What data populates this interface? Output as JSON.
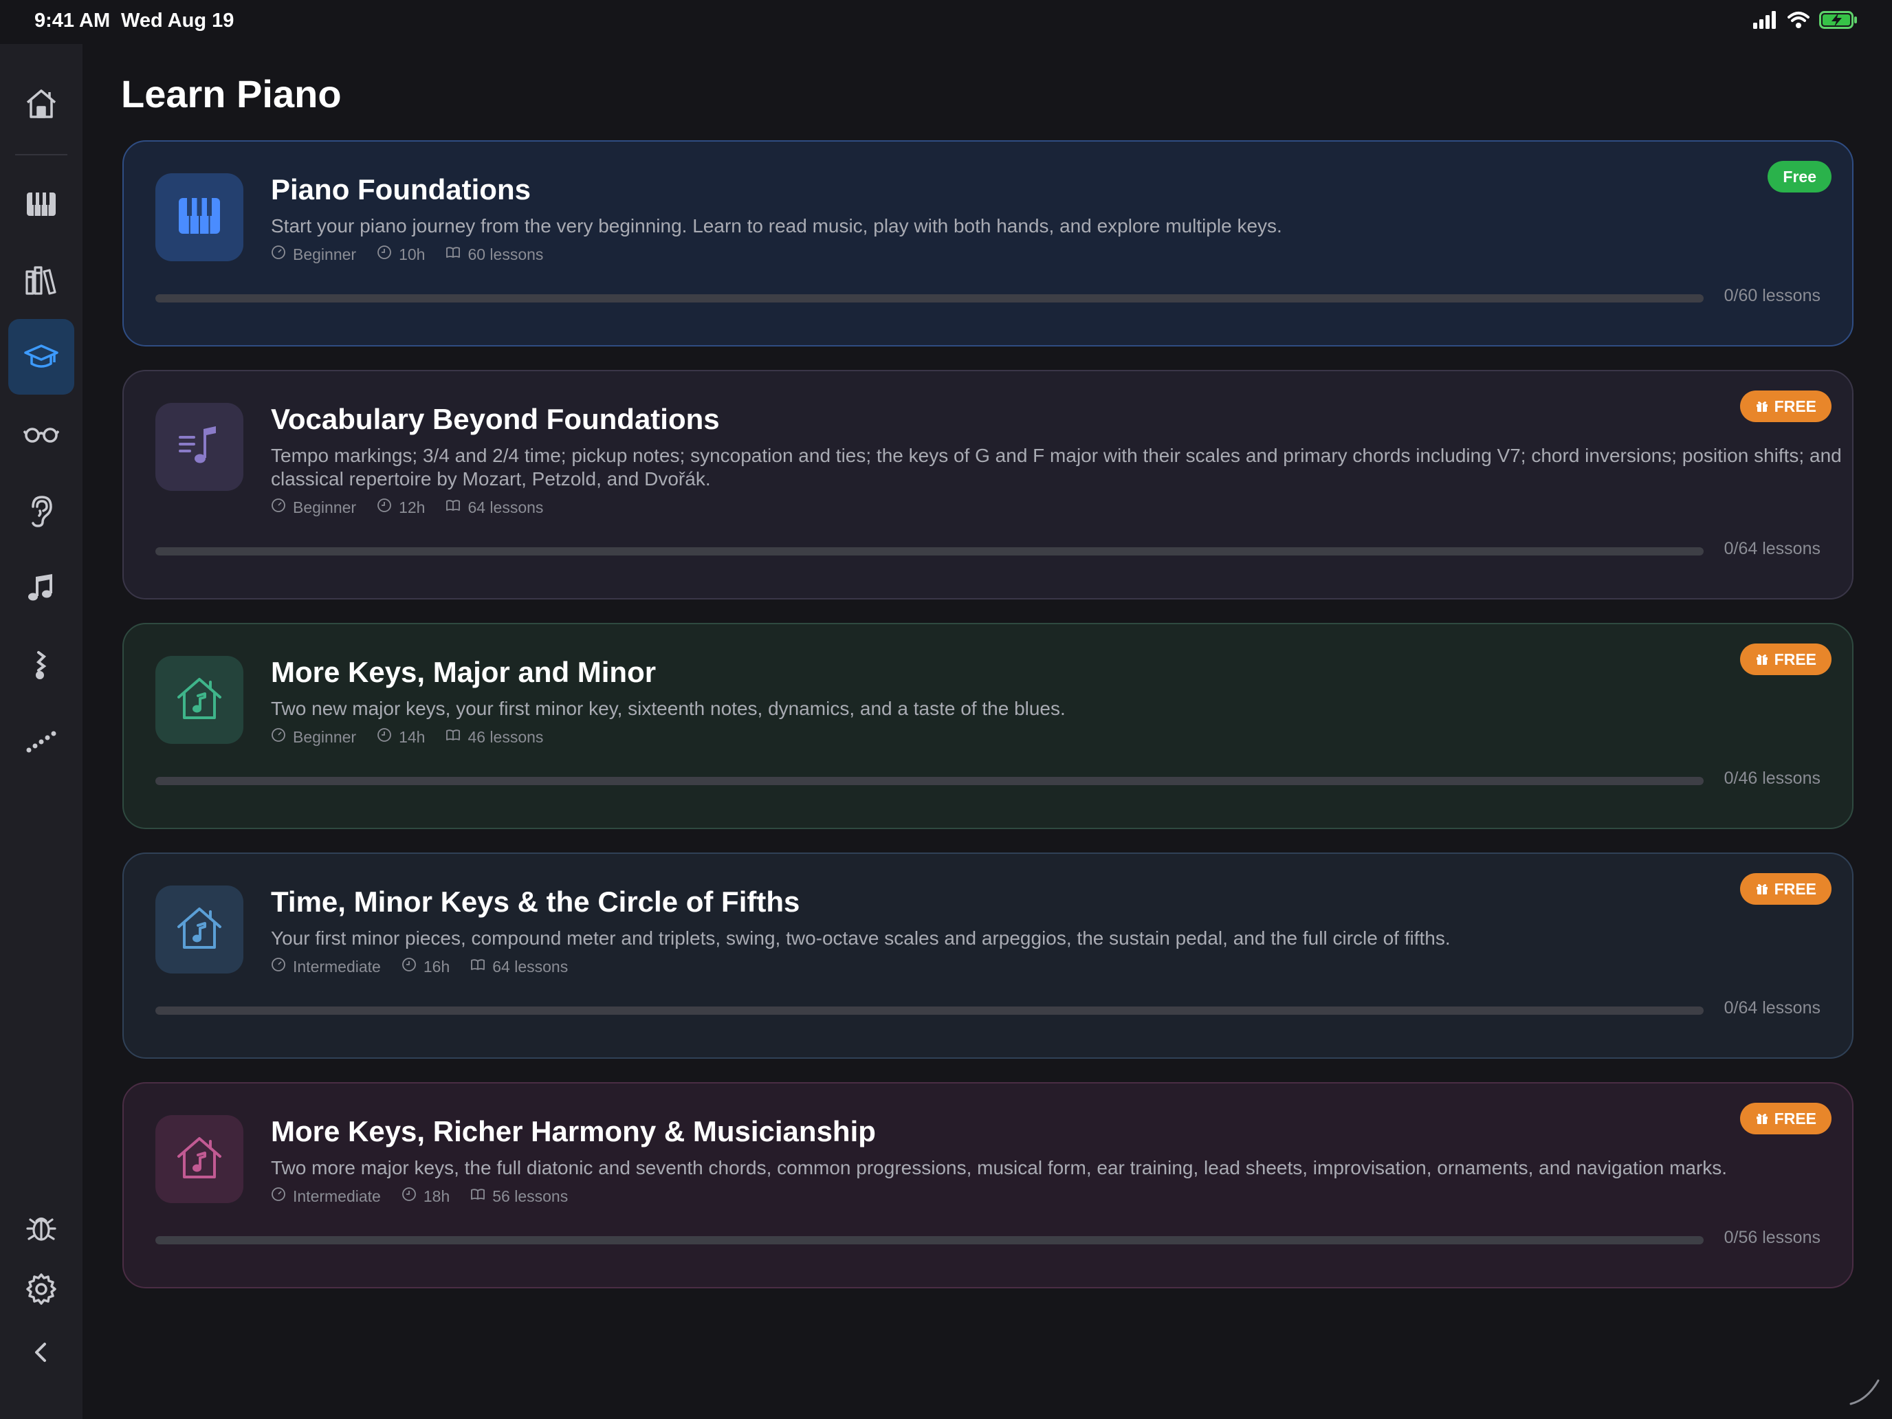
{
  "status": {
    "time": "9:41 AM",
    "date": "Wed Aug 19"
  },
  "sidebar": {
    "items": [
      {
        "name": "home",
        "icon": "house-icon"
      },
      {
        "name": "piano",
        "icon": "piano-keys-icon"
      },
      {
        "name": "library",
        "icon": "books-icon"
      },
      {
        "name": "learn",
        "icon": "graduation-cap-icon",
        "active": true
      },
      {
        "name": "sight-reading",
        "icon": "glasses-icon"
      },
      {
        "name": "ear-training",
        "icon": "ear-icon"
      },
      {
        "name": "songs",
        "icon": "music-note-icon"
      },
      {
        "name": "rhythm",
        "icon": "rhythm-icon"
      },
      {
        "name": "progress",
        "icon": "dotted-line-icon"
      },
      {
        "name": "debug",
        "icon": "bug-icon"
      },
      {
        "name": "settings",
        "icon": "gear-icon"
      },
      {
        "name": "collapse",
        "icon": "chevron-left-icon"
      }
    ]
  },
  "page": {
    "title": "Learn Piano"
  },
  "courses": [
    {
      "title": "Piano Foundations",
      "description": "Start your piano journey from the very beginning. Learn to read music, play with both hands, and explore multiple keys.",
      "level": "Beginner",
      "duration": "10h",
      "lessons": "60 lessons",
      "badge": "Free",
      "badge_color": "#2ab24b",
      "progress_label": "0/60 lessons",
      "progress": 0,
      "icon": "piano-keys-icon",
      "colors": {
        "bg": "#1a2438",
        "border": "#2f4d83",
        "icon_bg": "#24406f",
        "icon": "#4a8cff"
      }
    },
    {
      "title": "Vocabulary Beyond Foundations",
      "description": "Tempo markings; 3/4 and 2/4 time; pickup notes; syncopation and ties; the keys of G and F major with their scales and primary chords including V7; chord inversions; position shifts; and classical repertoire by Mozart, Petzold, and Dvořák.",
      "level": "Beginner",
      "duration": "12h",
      "lessons": "64 lessons",
      "badge": "FREE",
      "badge_color": "#e8862a",
      "progress_label": "0/64 lessons",
      "progress": 0,
      "icon": "music-list-icon",
      "colors": {
        "bg": "#211f2b",
        "border": "#3a3648",
        "icon_bg": "#342f47",
        "icon": "#8a7bc8"
      }
    },
    {
      "title": "More Keys, Major and Minor",
      "description": "Two new major keys, your first minor key, sixteenth notes, dynamics, and a taste of the blues.",
      "level": "Beginner",
      "duration": "14h",
      "lessons": "46 lessons",
      "badge": "FREE",
      "badge_color": "#e8862a",
      "progress_label": "0/46 lessons",
      "progress": 0,
      "icon": "music-house-icon",
      "colors": {
        "bg": "#1b2623",
        "border": "#2f4a40",
        "icon_bg": "#24433b",
        "icon": "#3fb58a"
      }
    },
    {
      "title": "Time, Minor Keys & the Circle of Fifths",
      "description": "Your first minor pieces, compound meter and triplets, swing, two-octave scales and arpeggios, the sustain pedal, and the full circle of fifths.",
      "level": "Intermediate",
      "duration": "16h",
      "lessons": "64 lessons",
      "badge": "FREE",
      "badge_color": "#e8862a",
      "progress_label": "0/64 lessons",
      "progress": 0,
      "icon": "music-house-icon",
      "colors": {
        "bg": "#1c222c",
        "border": "#304157",
        "icon_bg": "#273a50",
        "icon": "#5b9fd6"
      }
    },
    {
      "title": "More Keys, Richer Harmony & Musicianship",
      "description": "Two more major keys, the full diatonic and seventh chords, common progressions, musical form, ear training, lead sheets, improvisation, ornaments, and navigation marks.",
      "level": "Intermediate",
      "duration": "18h",
      "lessons": "56 lessons",
      "badge": "FREE",
      "badge_color": "#e8862a",
      "progress_label": "0/56 lessons",
      "progress": 0,
      "icon": "music-house-icon",
      "colors": {
        "bg": "#261c29",
        "border": "#4a2d44",
        "icon_bg": "#40253b",
        "icon": "#c25a93"
      }
    }
  ]
}
